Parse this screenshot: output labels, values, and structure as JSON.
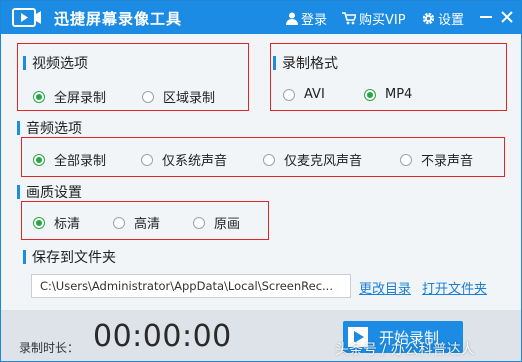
{
  "titlebar": {
    "app_title": "迅捷屏幕录像工具",
    "login_label": "登录",
    "vip_label": "购买VIP",
    "settings_label": "设置"
  },
  "video": {
    "title": "视频选项",
    "options": [
      "全屏录制",
      "区域录制"
    ],
    "selected": "全屏录制"
  },
  "format": {
    "title": "录制格式",
    "options": [
      "AVI",
      "MP4"
    ],
    "selected": "MP4"
  },
  "audio": {
    "title": "音频选项",
    "options": [
      "全部录制",
      "仅系统声音",
      "仅麦克风声音",
      "不录声音"
    ],
    "selected": "全部录制"
  },
  "quality": {
    "title": "画质设置",
    "options": [
      "标清",
      "高清",
      "原画"
    ],
    "selected": "标清"
  },
  "save": {
    "title": "保存到文件夹",
    "path": "C:\\Users\\Administrator\\AppData\\Local\\ScreenRec...",
    "change_label": "更改目录",
    "open_label": "打开文件夹"
  },
  "footer": {
    "duration_label": "录制时长：",
    "timer": "00:00:00",
    "start_label": "开始录制",
    "watermark": "头条号 / 办公科普达人"
  },
  "colors": {
    "accent": "#1c8be3",
    "radio_on": "#26a745",
    "highlight_box": "#e0262b"
  }
}
